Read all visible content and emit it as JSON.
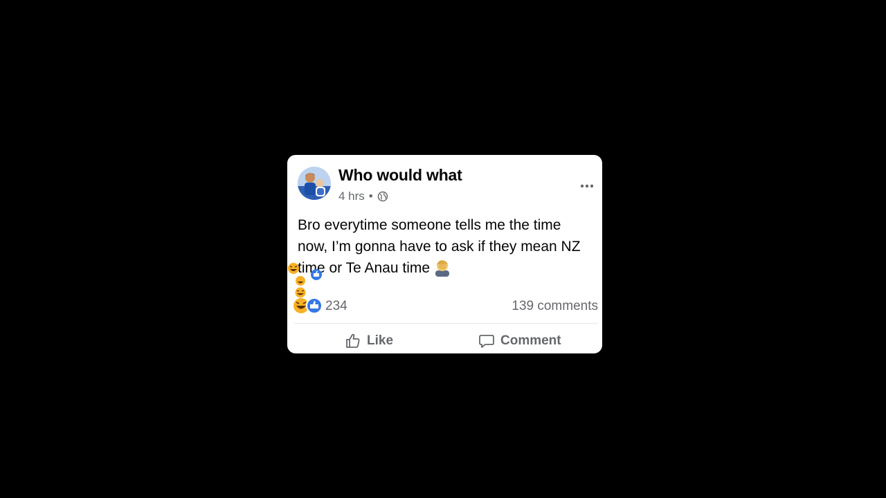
{
  "post": {
    "author": "Who would what",
    "time": "4 hrs",
    "separator": "•",
    "privacy_icon": "globe-icon",
    "more_icon": "more-options-icon",
    "text": "Bro everytime someone tells me the time now, I’m gonna have to ask if they mean NZ time or Te Anau time",
    "emoji": "facepalm-emoji"
  },
  "stats": {
    "reactions": "234",
    "comments": "139 comments",
    "reaction_icons": [
      "laugh-reaction-icon",
      "like-reaction-icon"
    ]
  },
  "actions": {
    "like_label": "Like",
    "comment_label": "Comment"
  },
  "colors": {
    "background": "#000000",
    "card": "#ffffff",
    "text": "#050505",
    "secondary_text": "#65676b",
    "like_blue": "#3578e5",
    "haha_yellow": "#f7b125"
  }
}
